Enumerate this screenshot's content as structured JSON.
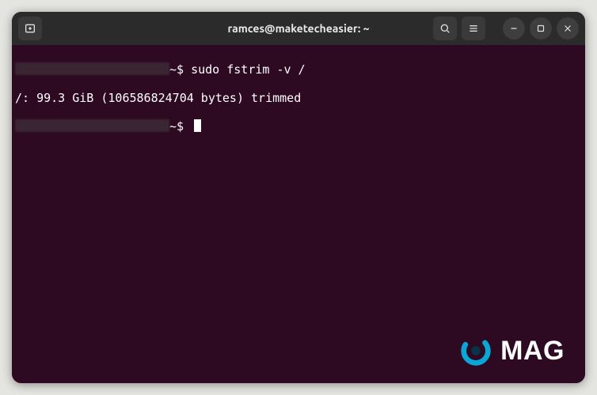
{
  "window": {
    "title": "ramces@maketecheasier: ~"
  },
  "icons": {
    "new_tab": "new-tab-icon",
    "search": "search-icon",
    "menu": "hamburger-menu-icon",
    "minimize": "minimize-icon",
    "maximize": "maximize-icon",
    "close": "close-icon"
  },
  "terminal": {
    "lines": [
      {
        "redacted": true,
        "prompt_tail": "~$ ",
        "command": "sudo fstrim -v /"
      },
      {
        "output": "/: 99.3 GiB (106586824704 bytes) trimmed"
      },
      {
        "redacted": true,
        "prompt_tail": "~$ ",
        "cursor": true
      }
    ]
  },
  "watermark": {
    "text": "MAG"
  },
  "colors": {
    "terminal_bg": "#2e0a22",
    "titlebar_bg": "#2b2b2b",
    "text": "#ffffff",
    "accent": "#0aa6d6"
  }
}
